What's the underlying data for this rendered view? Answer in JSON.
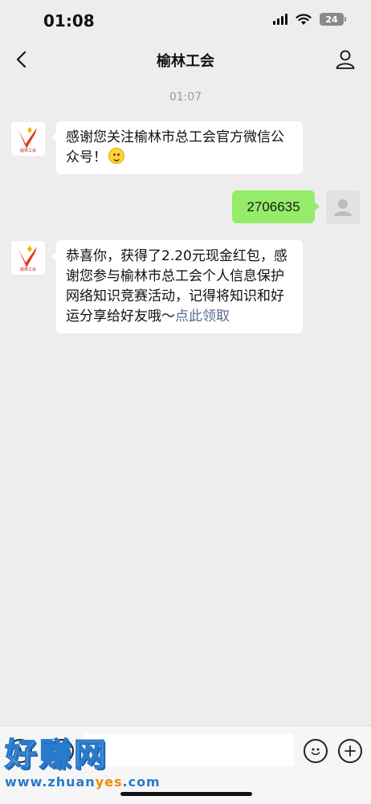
{
  "status_bar": {
    "time": "01:08",
    "battery": "24"
  },
  "header": {
    "title": "榆林工会"
  },
  "chat": {
    "timestamp": "01:07",
    "messages": [
      {
        "side": "left",
        "sender_logo_text": "榆林工会",
        "text": "感谢您关注榆林市总工会官方微信公众号！",
        "emoji": "smile-emoji"
      },
      {
        "side": "right",
        "text": "2706635"
      },
      {
        "side": "left",
        "sender_logo_text": "榆林工会",
        "text": "恭喜你，获得了2.20元现金红包，感谢您参与榆林市总工会个人信息保护网络知识竞赛活动，记得将知识和好运分享给好友哦～",
        "link_text": "点此领取"
      }
    ]
  },
  "input_bar": {
    "icons": [
      "voice-icon",
      "keyboard-icon",
      "emoji-icon",
      "plus-icon"
    ]
  },
  "watermark": {
    "main": "好赚网",
    "url_prefix": "www.zhuan",
    "url_highlight": "yes",
    "url_suffix": ".com"
  },
  "colors": {
    "background": "#ededed",
    "bubble_self": "#95ec69",
    "link": "#576b95"
  }
}
